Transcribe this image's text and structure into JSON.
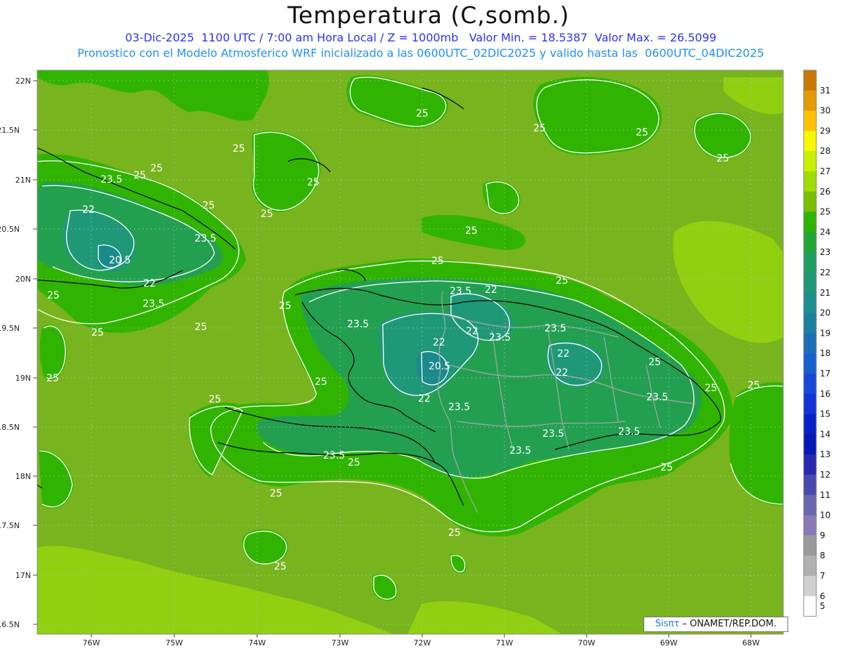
{
  "header": {
    "title": "Temperatura (C,somb.)",
    "line1": "03-Dic-2025  1100 UTC / 7:00 am Hora Local / Z = 1000mb   Valor Min. = 18.5387  Valor Max. = 26.5099",
    "line2": "Pronostico con el Modelo Atmosferico WRF inicializado a las 0600UTC_02DIC2025 y valido hasta las  0600UTC_04DIC2025"
  },
  "axes": {
    "lat_labels": [
      "22N",
      "21.5N",
      "21N",
      "20.5N",
      "20N",
      "19.5N",
      "19N",
      "18.5N",
      "18N",
      "17.5N",
      "17N",
      "16.5N"
    ],
    "lon_labels": [
      "76W",
      "75W",
      "74W",
      "73W",
      "72W",
      "71W",
      "70W",
      "69W",
      "68W"
    ]
  },
  "colorbar": {
    "levels": [
      "31",
      "30",
      "29",
      "28",
      "27",
      "26",
      "25",
      "24",
      "23",
      "22",
      "21",
      "20",
      "19",
      "18",
      "17",
      "16",
      "15",
      "14",
      "13",
      "12",
      "11",
      "10",
      "9",
      "8",
      "7",
      "6",
      "5"
    ],
    "colors": [
      "#c87800",
      "#e49a00",
      "#ffc000",
      "#f8f800",
      "#c8f000",
      "#a0dc00",
      "#78c000",
      "#30b400",
      "#22a636",
      "#20a060",
      "#1f9878",
      "#1e8e8e",
      "#1a80a0",
      "#1a70b8",
      "#1660d0",
      "#1548d8",
      "#1034d8",
      "#0820c8",
      "#0818b8",
      "#2828b0",
      "#4848b0",
      "#6868b0",
      "#8a78b8",
      "#9a9a9a",
      "#b0b0b0",
      "#d0d0d0",
      "#ffffff"
    ]
  },
  "map_colors": {
    "ocean": "#78b41e",
    "land_warm": "#30b400",
    "land_cool": "#22a050",
    "coldest": "#1a8a8a",
    "warm_sea": "#90d010"
  },
  "contour_labels": [
    "25",
    "23.5",
    "22",
    "20.5",
    "25",
    "23.5",
    "22",
    "25",
    "25",
    "25",
    "25",
    "25",
    "23.5",
    "22",
    "22",
    "20.5",
    "22",
    "23.5",
    "23.5",
    "22",
    "23.5",
    "23.5",
    "25",
    "25",
    "25",
    "25",
    "23.5",
    "25",
    "25",
    "25",
    "25",
    "25",
    "25",
    "25",
    "25",
    "25",
    "25",
    "25",
    "25",
    "25"
  ],
  "credit": {
    "logo": "Sisπτ",
    "text": "– ONAMET/REP.DOM."
  }
}
